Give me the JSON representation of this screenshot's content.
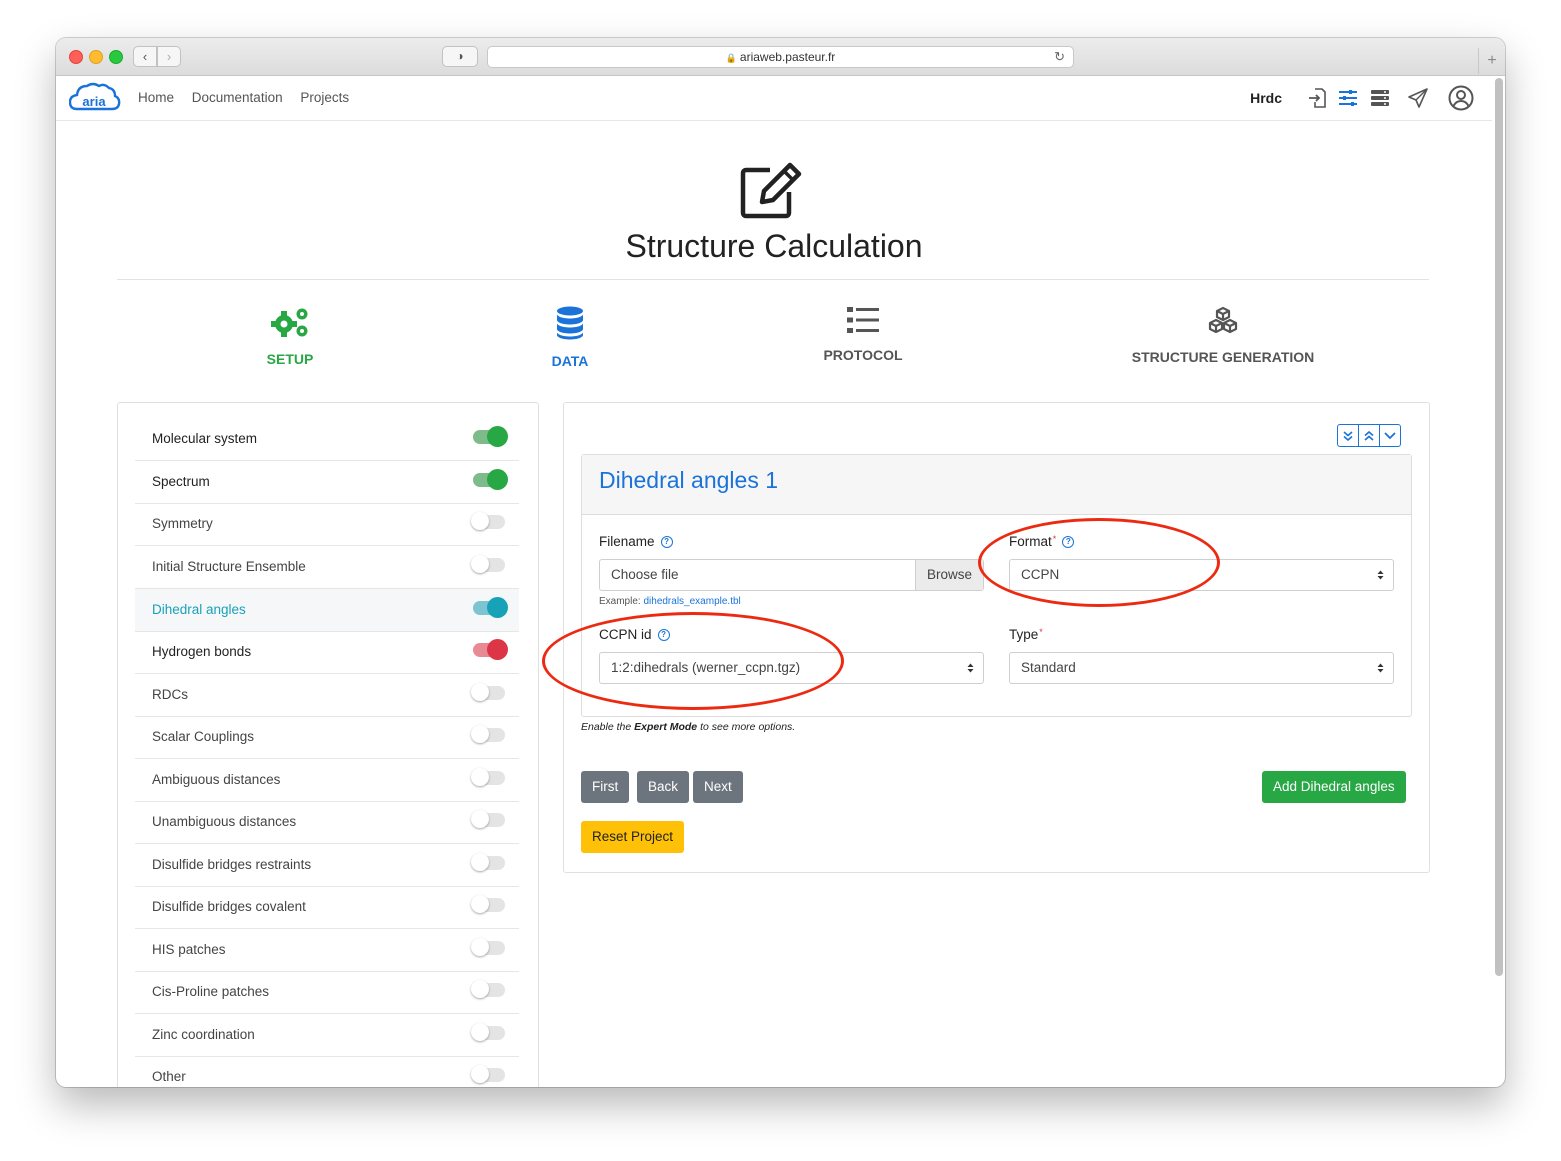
{
  "browser": {
    "url": "ariaweb.pasteur.fr",
    "back_icon": "chevron-left-icon",
    "forward_icon": "chevron-right-icon",
    "new_tab_label": "+"
  },
  "nav": {
    "links": [
      "Home",
      "Documentation",
      "Projects"
    ],
    "brand": "Hrdc",
    "logo_text": "aria"
  },
  "header": {
    "title": "Structure Calculation"
  },
  "steps": [
    {
      "label": "SETUP",
      "color": "#28a745",
      "icon": "gears-icon"
    },
    {
      "label": "DATA",
      "color": "#1a73d9",
      "icon": "database-icon"
    },
    {
      "label": "PROTOCOL",
      "color": "#555555",
      "icon": "list-icon"
    },
    {
      "label": "STRUCTURE GENERATION",
      "color": "#555555",
      "icon": "cubes-icon"
    }
  ],
  "sidebar": {
    "items": [
      {
        "label": "Molecular system",
        "state": "on",
        "color": "#28a745"
      },
      {
        "label": "Spectrum",
        "state": "on",
        "color": "#28a745"
      },
      {
        "label": "Symmetry",
        "state": "off"
      },
      {
        "label": "Initial Structure Ensemble",
        "state": "off"
      },
      {
        "label": "Dihedral angles",
        "state": "on",
        "color": "#17a2b8",
        "active": true
      },
      {
        "label": "Hydrogen bonds",
        "state": "on",
        "color": "#dc3545"
      },
      {
        "label": "RDCs",
        "state": "off"
      },
      {
        "label": "Scalar Couplings",
        "state": "off"
      },
      {
        "label": "Ambiguous distances",
        "state": "off"
      },
      {
        "label": "Unambiguous distances",
        "state": "off"
      },
      {
        "label": "Disulfide bridges restraints",
        "state": "off"
      },
      {
        "label": "Disulfide bridges covalent",
        "state": "off"
      },
      {
        "label": "HIS patches",
        "state": "off"
      },
      {
        "label": "Cis-Proline patches",
        "state": "off"
      },
      {
        "label": "Zinc coordination",
        "state": "off"
      },
      {
        "label": "Other",
        "state": "off"
      }
    ]
  },
  "form": {
    "card_title": "Dihedral angles 1",
    "filename_label": "Filename",
    "file_placeholder": "Choose file",
    "browse_label": "Browse",
    "example_prefix": "Example:",
    "example_link": "dihedrals_example.tbl",
    "format_label": "Format",
    "format_value": "CCPN",
    "ccpn_label": "CCPN id",
    "ccpn_value": "1:2:dihedrals (werner_ccpn.tgz)",
    "type_label": "Type",
    "type_value": "Standard",
    "required_mark": "*",
    "help_mark": "?",
    "expert_prefix": "Enable the",
    "expert_bold": "Expert Mode",
    "expert_suffix": "to see more options."
  },
  "buttons": {
    "first": "First",
    "back": "Back",
    "next": "Next",
    "add": "Add Dihedral angles",
    "reset": "Reset Project"
  },
  "colors": {
    "primary": "#1a73d9",
    "success": "#28a745",
    "warning": "#ffc107",
    "annotation": "#ec2a12"
  }
}
